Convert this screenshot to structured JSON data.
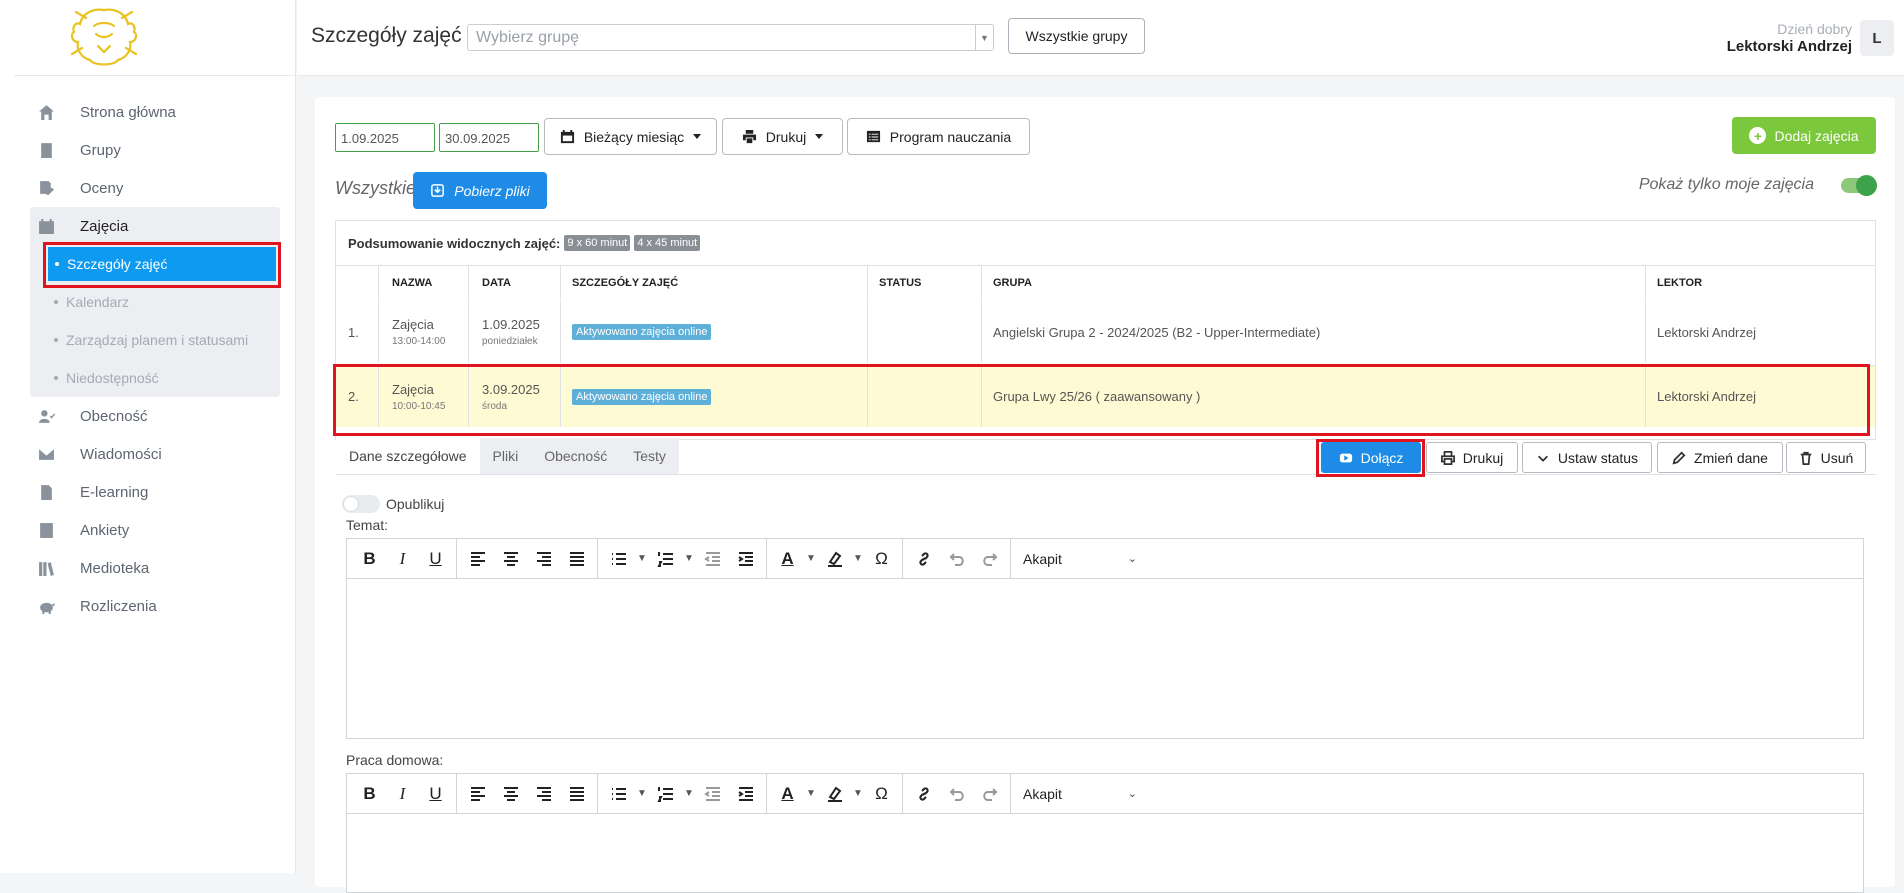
{
  "colors": {
    "accent": "#1e8ce6",
    "active_nav": "#0d9af0",
    "add_green": "#7cc83c",
    "highlight_row": "#fefbd4",
    "annotation": "#e0141e"
  },
  "sidebar": {
    "items": [
      {
        "label": "Strona główna",
        "icon": "home-icon"
      },
      {
        "label": "Grupy",
        "icon": "book-icon"
      },
      {
        "label": "Oceny",
        "icon": "grade-icon"
      },
      {
        "label": "Zajęcia",
        "icon": "calendar-icon"
      },
      {
        "label": "Obecność",
        "icon": "user-check-icon"
      },
      {
        "label": "Wiadomości",
        "icon": "envelope-icon"
      },
      {
        "label": "E-learning",
        "icon": "file-icon"
      },
      {
        "label": "Ankiety",
        "icon": "survey-icon"
      },
      {
        "label": "Medioteka",
        "icon": "library-icon"
      },
      {
        "label": "Rozliczenia",
        "icon": "piggy-bank-icon"
      }
    ],
    "sub_items": [
      "Szczegóły zajęć",
      "Kalendarz",
      "Zarządzaj planem i statusami",
      "Niedostępność"
    ]
  },
  "header": {
    "title": "Szczegóły zajęć",
    "group_placeholder": "Wybierz grupę",
    "all_groups": "Wszystkie grupy",
    "greeting": "Dzień dobry",
    "user": "Lektorski Andrzej",
    "avatar": "L"
  },
  "filters": {
    "date_from": "1.09.2025",
    "date_to": "30.09.2025",
    "current_month": "Bieżący miesiąc",
    "print": "Drukuj",
    "curriculum": "Program nauczania",
    "add": "Dodaj zajęcia",
    "all": "Wszystkie",
    "download": "Pobierz pliki",
    "only_mine": "Pokaż tylko moje zajęcia",
    "only_mine_on": true
  },
  "table": {
    "summary_label": "Podsumowanie widocznych zajęć:",
    "summary_badges": [
      "9 x 60 minut",
      "4 x 45 minut"
    ],
    "headers": [
      "NAZWA",
      "DATA",
      "SZCZEGÓŁY ZAJĘĆ",
      "STATUS",
      "GRUPA",
      "LEKTOR"
    ],
    "rows": [
      {
        "num": "1.",
        "name": "Zajęcia",
        "time": "13:00-14:00",
        "date": "1.09.2025",
        "day": "poniedziałek",
        "details": "Aktywowano zajęcia online",
        "status": "",
        "group": "Angielski Grupa 2 - 2024/2025 (B2 - Upper-Intermediate)",
        "teacher": "Lektorski Andrzej"
      },
      {
        "num": "2.",
        "name": "Zajęcia",
        "time": "10:00-10:45",
        "date": "3.09.2025",
        "day": "środa",
        "details": "Aktywowano zajęcia online",
        "status": "",
        "group": "Grupa Lwy 25/26 ( zaawansowany )",
        "teacher": "Lektorski Andrzej"
      }
    ]
  },
  "detail": {
    "tabs": [
      "Dane szczegółowe",
      "Pliki",
      "Obecność",
      "Testy"
    ],
    "actions": {
      "join": "Dołącz",
      "print": "Drukuj",
      "set_status": "Ustaw status",
      "edit": "Zmień dane",
      "delete": "Usuń"
    },
    "publish": "Opublikuj",
    "topic_label": "Temat:",
    "homework_label": "Praca domowa:",
    "paragraph": "Akapit"
  }
}
